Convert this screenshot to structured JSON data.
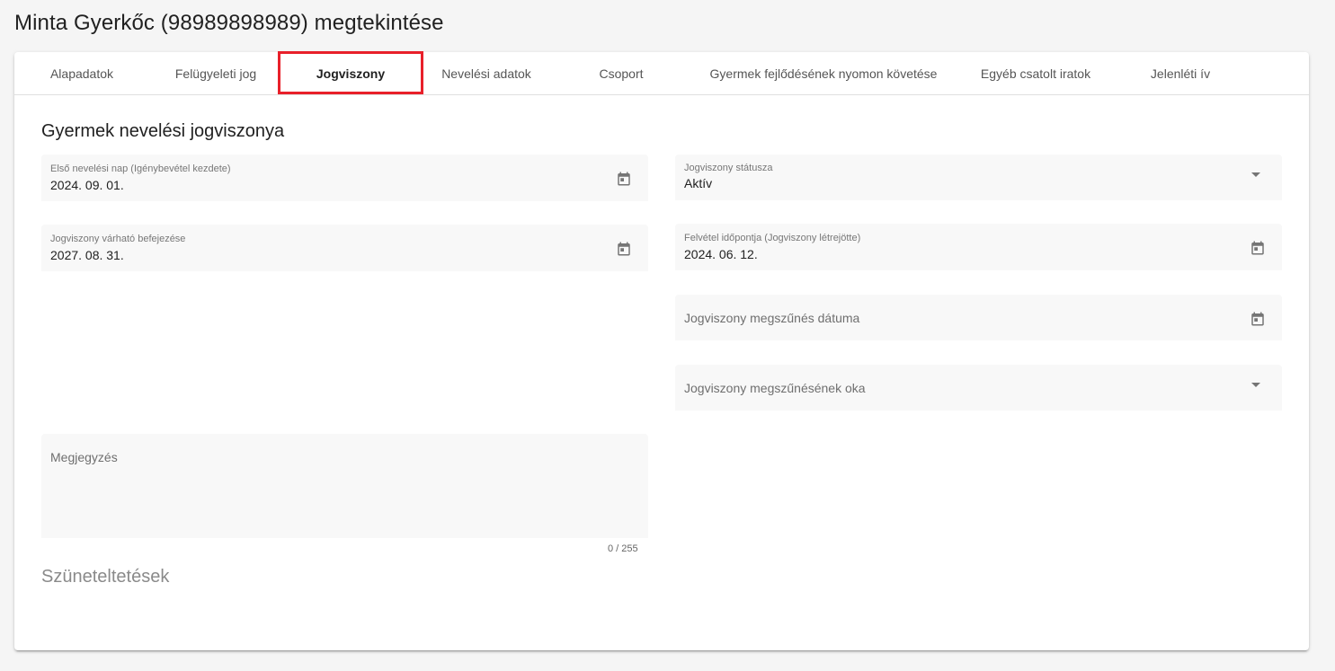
{
  "page": {
    "title": "Minta Gyerkőc (98989898989) megtekintése"
  },
  "tabs": [
    {
      "label": "Alapadatok",
      "active": false
    },
    {
      "label": "Felügyeleti jog",
      "active": false
    },
    {
      "label": "Jogviszony",
      "active": true
    },
    {
      "label": "Nevelési adatok",
      "active": false
    },
    {
      "label": "Csoport",
      "active": false
    },
    {
      "label": "Gyermek fejlődésének nyomon követése",
      "active": false
    },
    {
      "label": "Egyéb csatolt iratok",
      "active": false
    },
    {
      "label": "Jelenléti ív",
      "active": false
    }
  ],
  "section": {
    "title": "Gyermek nevelési jogviszonya",
    "suspensions_title": "Szüneteltetések"
  },
  "fields": {
    "first_day": {
      "label": "Első nevelési nap (Igénybevétel kezdete)",
      "value": "2024. 09. 01.",
      "icon": "calendar-icon"
    },
    "status": {
      "label": "Jogviszony státusza",
      "value": "Aktív",
      "icon": "dropdown-arrow-icon"
    },
    "expected_end": {
      "label": "Jogviszony várható befejezése",
      "value": "2027. 08. 31.",
      "icon": "calendar-icon"
    },
    "admission": {
      "label": "Felvétel időpontja (Jogviszony létrejötte)",
      "value": "2024. 06. 12.",
      "icon": "calendar-icon"
    },
    "termination_date": {
      "placeholder": "Jogviszony megszűnés dátuma",
      "icon": "calendar-icon"
    },
    "termination_reason": {
      "placeholder": "Jogviszony megszűnésének oka",
      "icon": "dropdown-arrow-icon"
    },
    "note": {
      "placeholder": "Megjegyzés",
      "counter": "0 / 255"
    }
  },
  "colors": {
    "highlight": "#e8202a",
    "field_bg": "#f8f8f8",
    "page_bg": "#f5f5f5"
  }
}
